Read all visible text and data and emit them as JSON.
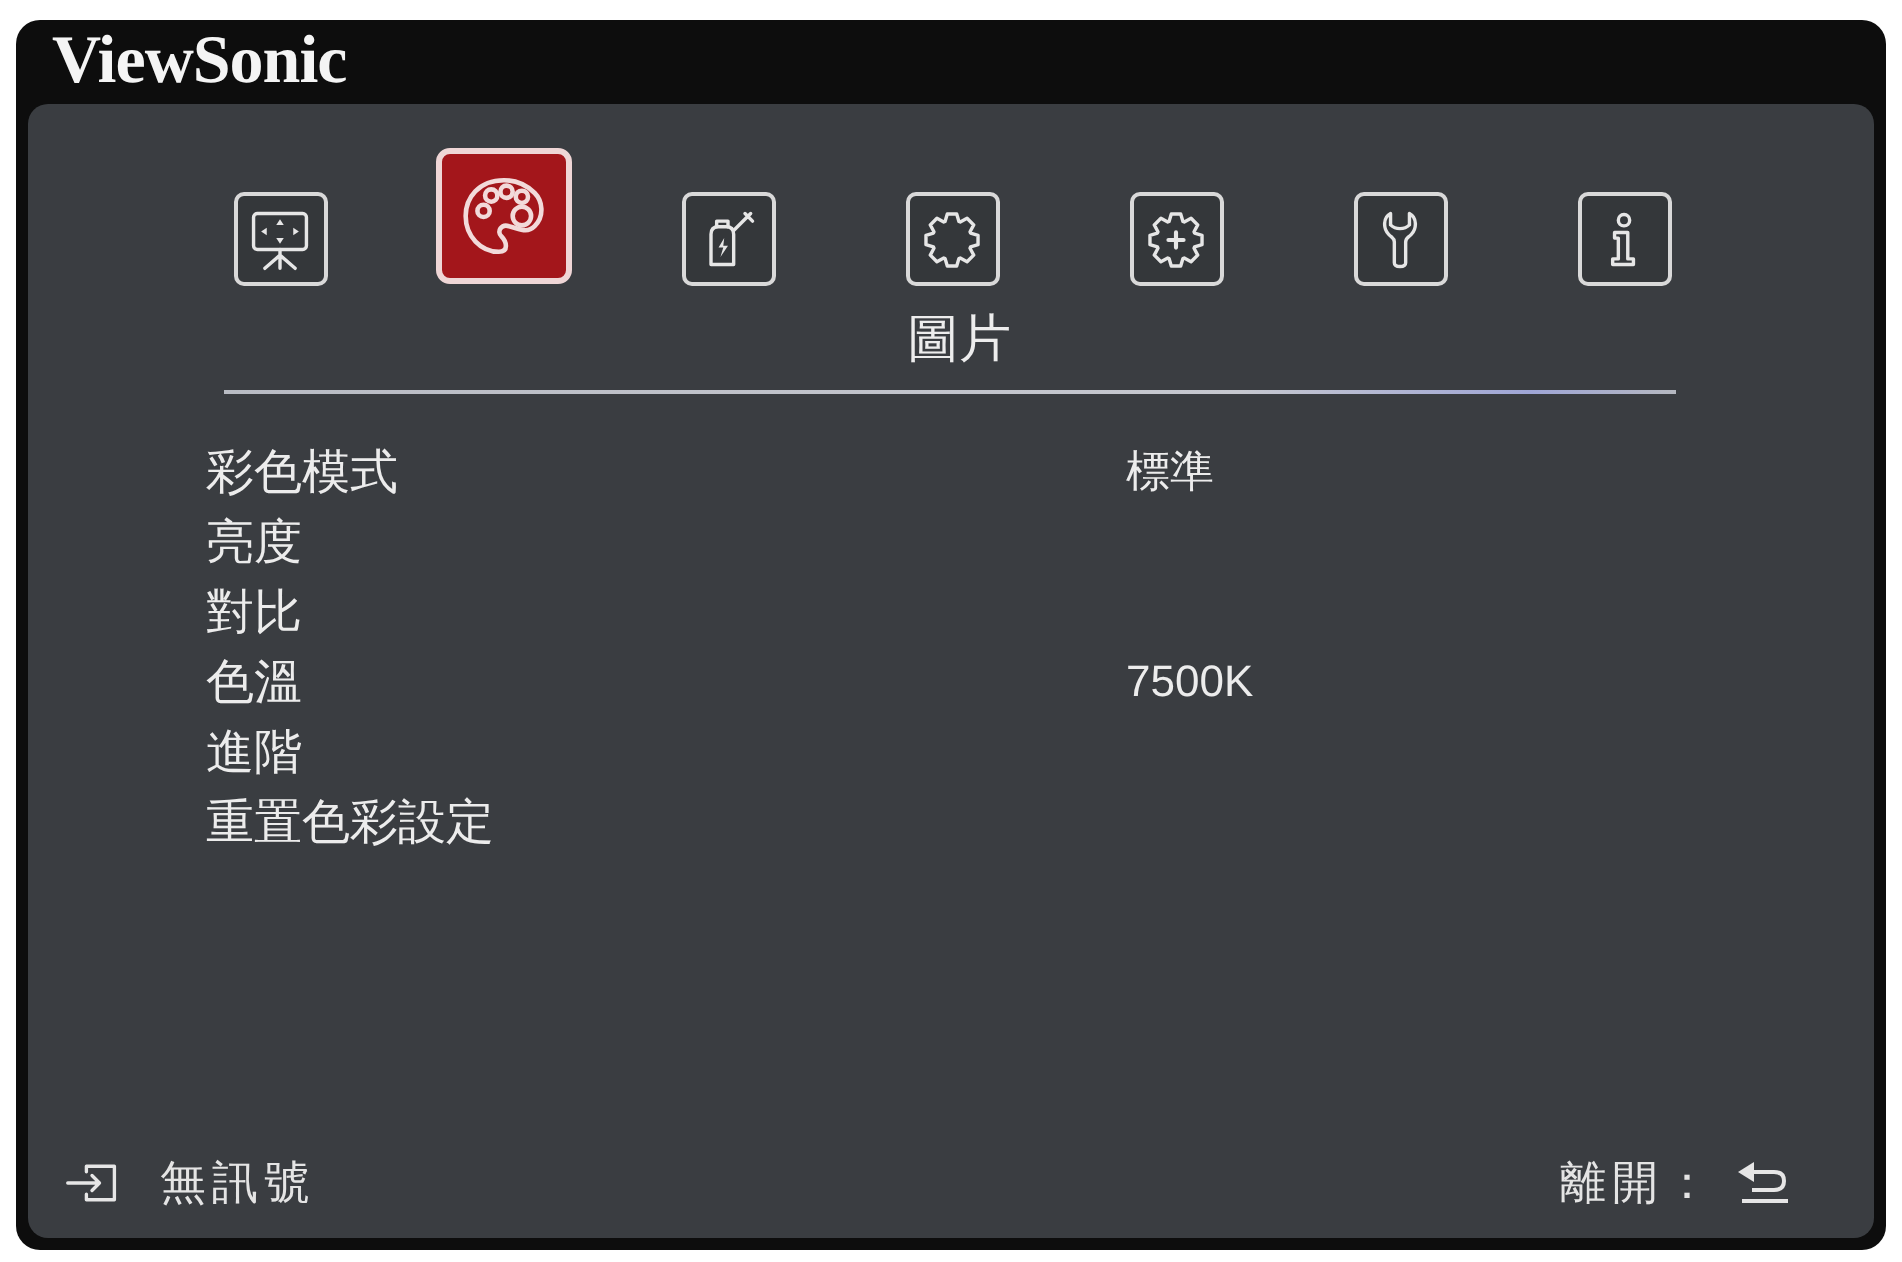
{
  "brand": {
    "name": "ViewSonic"
  },
  "tabs": [
    {
      "kind": "screen",
      "selected": false
    },
    {
      "kind": "palette",
      "selected": true
    },
    {
      "kind": "battery",
      "selected": false
    },
    {
      "kind": "gear",
      "selected": false
    },
    {
      "kind": "gear-plus",
      "selected": false
    },
    {
      "kind": "wrench",
      "selected": false
    },
    {
      "kind": "info",
      "selected": false
    }
  ],
  "section_title": "圖片",
  "settings": [
    {
      "label": "彩色模式",
      "value": "標準"
    },
    {
      "label": "亮度"
    },
    {
      "label": "對比"
    },
    {
      "label": "色溫",
      "value": "7500K"
    },
    {
      "label": "進階"
    },
    {
      "label": "重置色彩設定"
    }
  ],
  "status_bar": {
    "input_status": "無訊號",
    "exit_label": "離開："
  }
}
